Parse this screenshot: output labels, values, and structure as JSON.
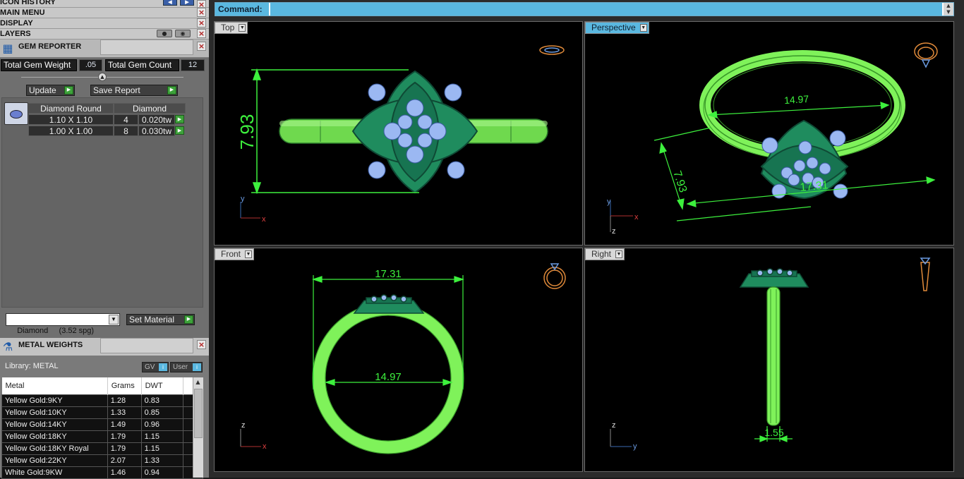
{
  "panels": {
    "icon_history": "ICON HISTORY",
    "main_menu": "MAIN MENU",
    "display": "DISPLAY",
    "layers": "LAYERS",
    "gem_reporter": "GEM REPORTER",
    "metal_weights": "METAL WEIGHTS"
  },
  "gem_reporter": {
    "total_gem_weight_label": "Total Gem Weight",
    "total_gem_weight": ".05",
    "total_gem_count_label": "Total Gem Count",
    "total_gem_count": "12",
    "update_label": "Update",
    "save_report_label": "Save Report",
    "group": {
      "shape": "Diamond Round",
      "material": "Diamond"
    },
    "rows": [
      {
        "size": "1.10 X 1.10",
        "count": "4",
        "weight": "0.020tw"
      },
      {
        "size": "1.00 X 1.00",
        "count": "8",
        "weight": "0.030tw"
      }
    ],
    "material_select": "Diamond     (3.52 spg)",
    "set_material_label": "Set Material"
  },
  "metal_weights": {
    "library_label": "Library: METAL",
    "gv_label": "GV",
    "user_label": "User",
    "columns": [
      "Metal",
      "Grams",
      "DWT"
    ],
    "rows": [
      [
        "Yellow Gold:9KY",
        "1.28",
        "0.83"
      ],
      [
        "Yellow Gold:10KY",
        "1.33",
        "0.85"
      ],
      [
        "Yellow Gold:14KY",
        "1.49",
        "0.96"
      ],
      [
        "Yellow Gold:18KY",
        "1.79",
        "1.15"
      ],
      [
        "Yellow Gold:18KY Royal",
        "1.79",
        "1.15"
      ],
      [
        "Yellow Gold:22KY",
        "2.07",
        "1.33"
      ],
      [
        "White Gold:9KW",
        "1.46",
        "0.94"
      ]
    ]
  },
  "command": {
    "label": "Command:"
  },
  "viewports": {
    "top": {
      "label": "Top",
      "dim_vertical": "7.93",
      "axis_y": "y",
      "axis_x": "x"
    },
    "perspective": {
      "label": "Perspective",
      "dim_width": "14.97",
      "dim_height": "7.93",
      "dim_length": "17.31",
      "axis_y": "y",
      "axis_x": "x",
      "axis_z": "z"
    },
    "front": {
      "label": "Front",
      "dim_outer": "17.31",
      "dim_inner": "14.97",
      "axis_z": "z",
      "axis_x": "x"
    },
    "right": {
      "label": "Right",
      "dim_thickness": "1.55",
      "axis_z": "z",
      "axis_y": "y"
    }
  },
  "colors": {
    "ring_green": "#7ff25a",
    "ring_dark": "#1f8c5e",
    "gem_blue": "#9bb8f2",
    "dim_green": "#3df03d",
    "accent_blue": "#5ab8e0",
    "preview_orange": "#e08a3a"
  }
}
